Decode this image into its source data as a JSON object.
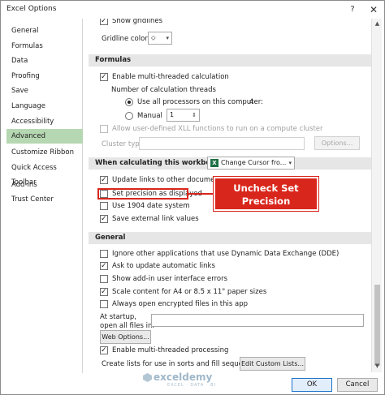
{
  "window": {
    "title": "Excel Options",
    "help": "?",
    "close": "✕"
  },
  "sidebar": {
    "items": [
      {
        "label": "General"
      },
      {
        "label": "Formulas"
      },
      {
        "label": "Data"
      },
      {
        "label": "Proofing"
      },
      {
        "label": "Save"
      },
      {
        "label": "Language"
      },
      {
        "label": "Accessibility"
      },
      {
        "label": "Advanced",
        "active": true
      },
      {
        "label": "Customize Ribbon"
      },
      {
        "label": "Quick Access Toolbar"
      },
      {
        "label": "Add-ins"
      },
      {
        "label": "Trust Center"
      }
    ]
  },
  "display": {
    "show_gridlines": "Show gridlines",
    "gridline_color_label": "Gridline color"
  },
  "formulas": {
    "header": "Formulas",
    "multithreaded": "Enable multi-threaded calculation",
    "threads_label": "Number of calculation threads",
    "use_all": "Use all processors on this computer:",
    "processor_count": "4",
    "manual": "Manual",
    "manual_value": "1",
    "xll": "Allow user-defined XLL functions to run on a compute cluster",
    "cluster_type": "Cluster type:",
    "options_btn": "Options..."
  },
  "workbook": {
    "header": "When calculating this workbook:",
    "workbook_name": "Change Cursor fro...",
    "update_links": "Update links to other documents",
    "set_precision": "Set precision as displayed",
    "date_system": "Use 1904 date system",
    "save_external": "Save external link values"
  },
  "general": {
    "header": "General",
    "ignore_dde": "Ignore other applications that use Dynamic Data Exchange (DDE)",
    "ask_update": "Ask to update automatic links",
    "addin_errors": "Show add-in user interface errors",
    "scale_content": "Scale content for A4 or 8.5 x 11\" paper sizes",
    "open_encrypted": "Always open encrypted files in this app",
    "startup_line1": "At startup,",
    "startup_line2": "open all files in:",
    "web_options": "Web Options...",
    "multithreaded_processing": "Enable multi-threaded processing",
    "custom_lists_label": "Create lists for use in sorts and fill sequences:",
    "edit_lists": "Edit Custom Lists..."
  },
  "callout": {
    "line1": "Uncheck Set",
    "line2": "Precision"
  },
  "footer": {
    "ok": "OK",
    "cancel": "Cancel"
  },
  "watermark": {
    "name": "exceldemy",
    "tagline": "EXCEL · DATA · BI"
  },
  "colors": {
    "accent_red": "#d9261c",
    "nav_active": "#b5d7b1",
    "excel_green": "#1d7044"
  }
}
